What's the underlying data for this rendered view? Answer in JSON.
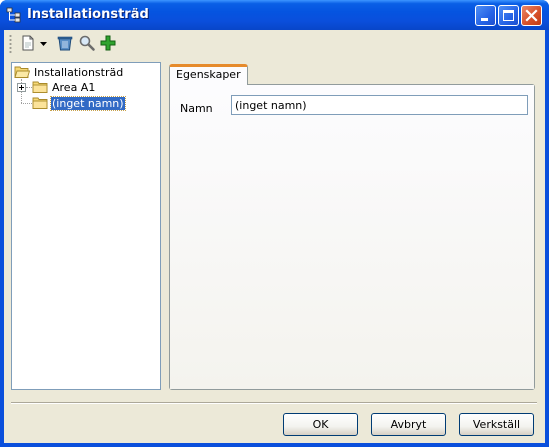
{
  "window": {
    "title": "Installationsträd"
  },
  "toolbar": {
    "icons": [
      "new-item-icon",
      "dropdown-arrow-icon",
      "delete-icon",
      "search-icon",
      "add-icon"
    ]
  },
  "tree": {
    "root": "Installationsträd",
    "children": [
      {
        "label": "Area A1",
        "expandable": true
      },
      {
        "label": "(inget namn)",
        "selected": true
      }
    ]
  },
  "tabs": [
    {
      "label": "Egenskaper",
      "active": true
    }
  ],
  "properties": {
    "name_label": "Namn",
    "name_value": "(inget namn)"
  },
  "buttons": {
    "ok": "OK",
    "cancel": "Avbryt",
    "apply": "Verkställ"
  },
  "colors": {
    "titlebar": "#0a4fdc",
    "selection": "#316ac5",
    "close_button": "#d8522b",
    "tab_accent": "#e68b2c"
  }
}
